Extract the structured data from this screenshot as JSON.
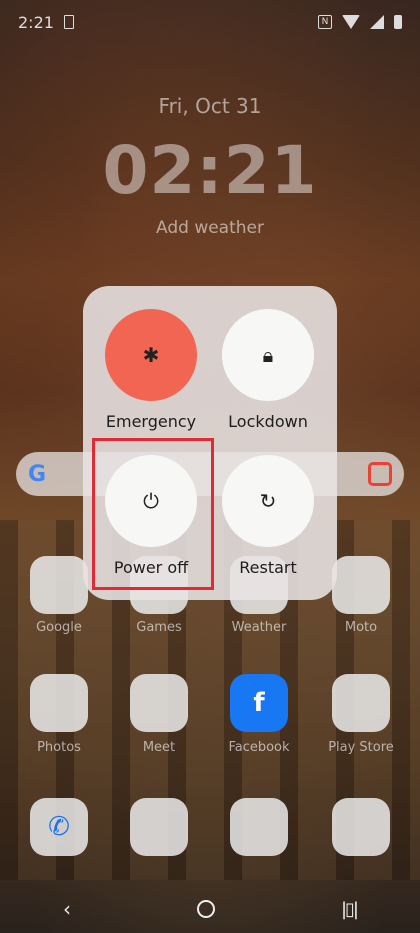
{
  "status_bar": {
    "time": "2:21"
  },
  "lockscreen": {
    "date": "Fri, Oct 31",
    "time": "02:21",
    "weather": "Add weather"
  },
  "search_bar": {
    "logo": "G"
  },
  "apps": {
    "row1": [
      "Google",
      "Games",
      "Weather",
      "Moto"
    ],
    "row2": [
      "Photos",
      "Meet",
      "Facebook",
      "Play Store"
    ]
  },
  "power_menu": {
    "emergency": {
      "label": "Emergency",
      "icon": "asterisk-icon",
      "color": "#f26552"
    },
    "lockdown": {
      "label": "Lockdown",
      "icon": "lock-icon"
    },
    "power_off": {
      "label": "Power off",
      "icon": "power-icon"
    },
    "restart": {
      "label": "Restart",
      "icon": "restart-icon"
    }
  },
  "highlight_color": "#e02a35"
}
